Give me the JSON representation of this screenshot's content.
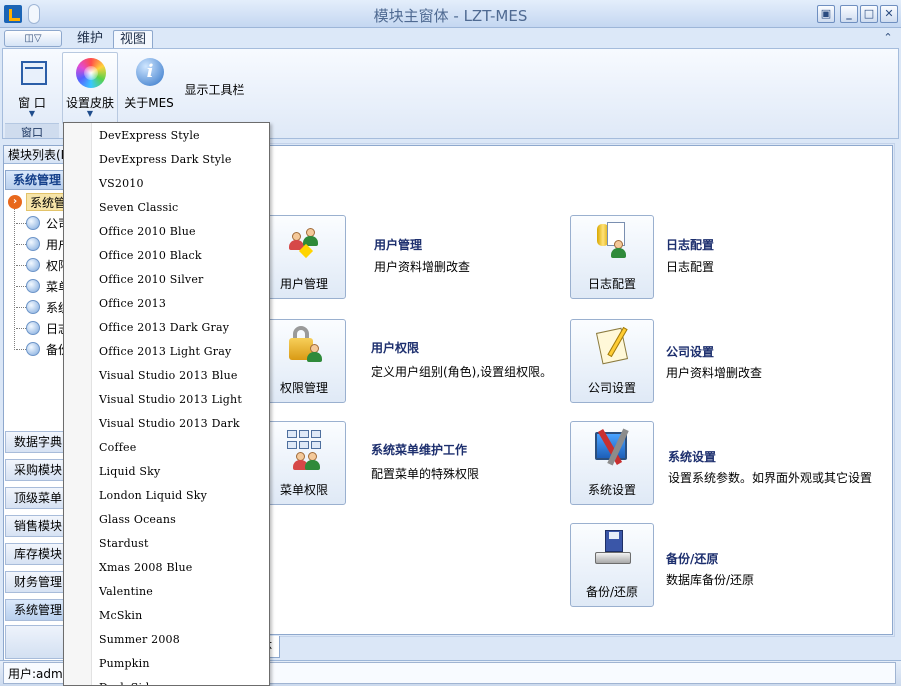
{
  "window": {
    "title": "模块主窗体 - LZT-MES",
    "buttons": [
      "restore-alt",
      "minimize",
      "maximize",
      "close"
    ]
  },
  "ribbon": {
    "app_menu_glyph": "◫▽",
    "tabs": [
      {
        "label": "维护",
        "selected": false
      },
      {
        "label": "视图",
        "selected": true
      }
    ],
    "collapse_glyph": "⌃",
    "buttons": {
      "window": "窗 口",
      "skin": "设置皮肤",
      "about": "关于MES",
      "toolbar": "显示工具栏"
    },
    "group_label": "窗口"
  },
  "sidebar": {
    "header": "模块列表(M",
    "group_title": "系统管理",
    "tree_root": "系统管",
    "tree_items": [
      "公司",
      "用户",
      "权限",
      "菜单",
      "系统",
      "日志",
      "备份"
    ],
    "nav_groups": [
      {
        "label": "数据字典",
        "selected": false
      },
      {
        "label": "采购模块",
        "selected": false
      },
      {
        "label": "顶级菜单",
        "selected": false
      },
      {
        "label": "销售模块",
        "selected": false
      },
      {
        "label": "库存模块",
        "selected": false
      },
      {
        "label": "财务管理",
        "selected": false
      },
      {
        "label": "系统管理",
        "selected": true
      }
    ]
  },
  "modules": [
    {
      "tile": "用户管理",
      "title": "用户管理",
      "desc": "用户资料增删改查",
      "icon": "users-icon"
    },
    {
      "tile": "日志配置",
      "title": "日志配置",
      "desc": "日志配置",
      "icon": "log-config-icon"
    },
    {
      "tile": "权限管理",
      "title": "用户权限",
      "desc": "定义用户组别(角色),设置组权限。",
      "icon": "permission-lock-icon"
    },
    {
      "tile": "公司设置",
      "title": "公司设置",
      "desc": "用户资料增删改查",
      "icon": "notepad-pencil-icon"
    },
    {
      "tile": "菜单权限",
      "title": "系统菜单维护工作",
      "desc": "配置菜单的特殊权限",
      "icon": "menu-tree-users-icon"
    },
    {
      "tile": "系统设置",
      "title": "系统设置",
      "desc": "设置系统参数。如界面外观或其它设置",
      "icon": "tools-icon"
    },
    {
      "tile": "备份/还原",
      "title": "备份/还原",
      "desc": "数据库备份/还原",
      "icon": "database-backup-icon"
    }
  ],
  "content_tab": "体",
  "status": {
    "user": "用户:admi"
  },
  "skin_menu": {
    "items": [
      "DevExpress Style",
      "DevExpress Dark Style",
      "VS2010",
      "Seven Classic",
      "Office 2010 Blue",
      "Office 2010 Black",
      "Office 2010 Silver",
      "Office 2013",
      "Office 2013 Dark Gray",
      "Office 2013 Light Gray",
      "Visual Studio 2013 Blue",
      "Visual Studio 2013 Light",
      "Visual Studio 2013 Dark",
      "Coffee",
      "Liquid Sky",
      "London Liquid Sky",
      "Glass Oceans",
      "Stardust",
      "Xmas 2008 Blue",
      "Valentine",
      "McSkin",
      "Summer 2008",
      "Pumpkin",
      "Dark Side"
    ]
  },
  "colors": {
    "accent": "#15408a",
    "title_text": "#4f6a92",
    "module_title": "#1d2f6e",
    "tree_selection": "#f6e4a8"
  }
}
